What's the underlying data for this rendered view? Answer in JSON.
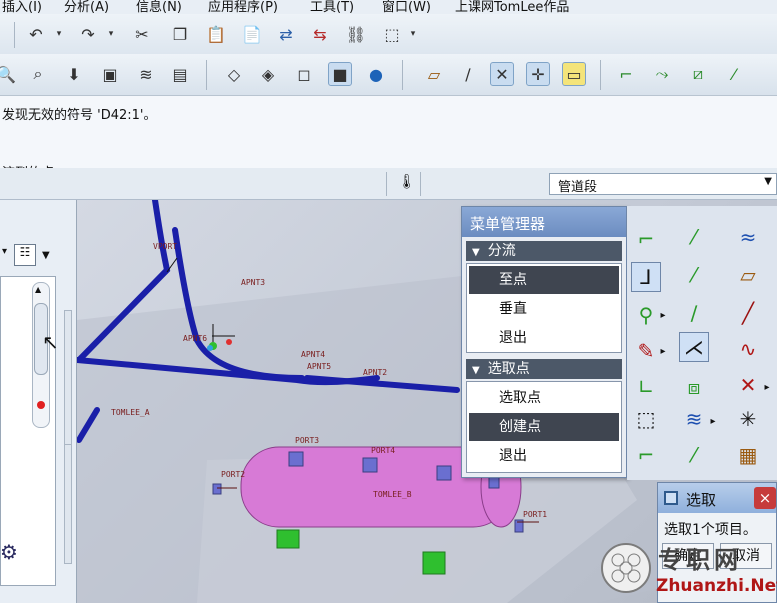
{
  "menubar": {
    "items": [
      "插入(I)",
      "分析(A)",
      "信息(N)",
      "应用程序(P)",
      "工具(T)",
      "窗口(W)",
      "上课网TomLee作品"
    ]
  },
  "message": {
    "line1": "发现无效的符号 'D42:1'。",
    "line2": "流到的点。"
  },
  "filter": {
    "value": "管道段"
  },
  "menu_manager": {
    "title": "菜单管理器",
    "group1": {
      "label": "分流",
      "items": [
        "至点",
        "垂直",
        "退出"
      ]
    },
    "group2": {
      "label": "选取点",
      "items": [
        "选取点",
        "创建点",
        "退出"
      ]
    }
  },
  "select_dialog": {
    "title": "选取",
    "close_label": "×",
    "text": "选取1个项目。",
    "ok_label": "确定",
    "cancel_label": "取消"
  },
  "viewport_labels": {
    "vport": "VPORT",
    "apnt3": "APNT3",
    "apnt6": "APNT6",
    "apnt4": "APNT4",
    "apnt5": "APNT5",
    "apnt2": "APNT2",
    "tomlee_a": "TOMLEE_A",
    "port3": "PORT3",
    "port4": "PORT4",
    "port2": "PORT2",
    "port1": "PORT1",
    "tomlee_b": "TOMLEE_B"
  },
  "watermark": {
    "line1": "专职网",
    "line2": "Zhuanzhi.Net"
  },
  "colors": {
    "pipe": "#1a1fa8",
    "tank": "#d77ad6",
    "support": "#2fbf2f",
    "highlight": "#3f4550"
  }
}
